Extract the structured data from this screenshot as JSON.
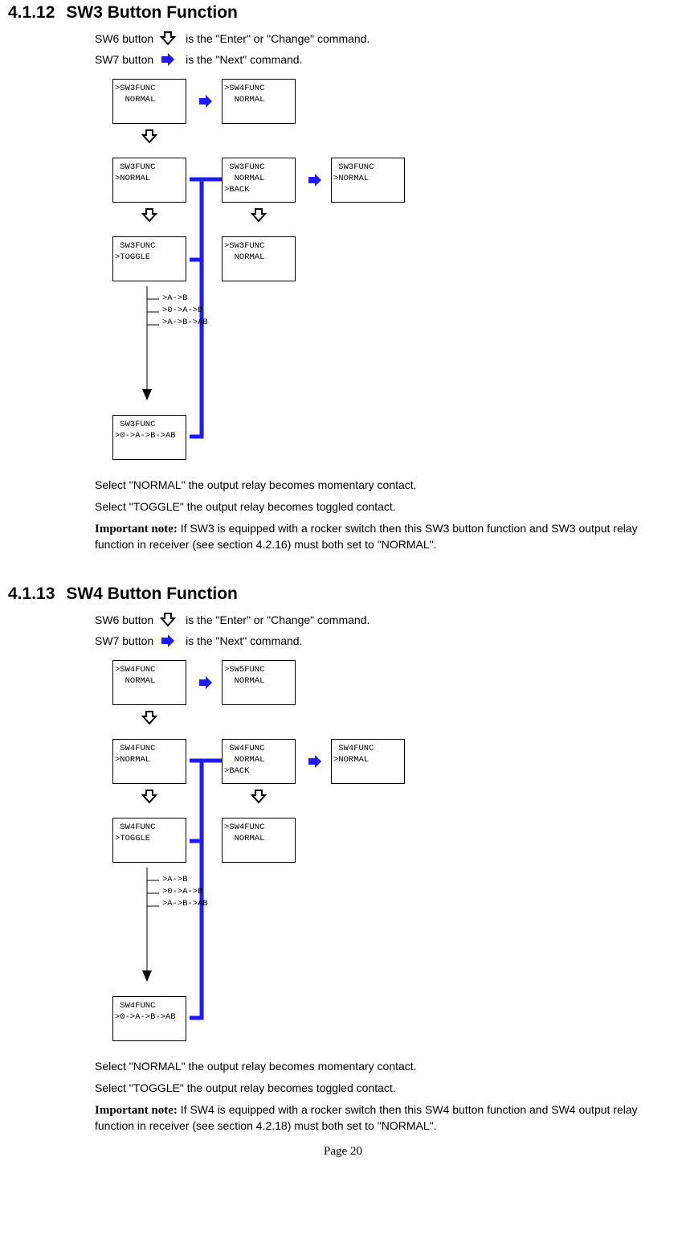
{
  "sections": [
    {
      "number": "4.1.12",
      "title": "SW3 Button Function",
      "sw6_before": "SW6 button",
      "sw6_after": "is the \"Enter\" or \"Change\" command.",
      "sw7_before": "SW7 button",
      "sw7_after": "is the \"Next\" command.",
      "boxes": {
        "top1": {
          "l1": ">SW3FUNC",
          "l2": "  NORMAL"
        },
        "top2": {
          "l1": ">SW4FUNC",
          "l2": "  NORMAL"
        },
        "r2a": {
          "l1": " SW3FUNC",
          "l2": ">NORMAL"
        },
        "r2b": {
          "l1": " SW3FUNC",
          "l2": "  NORMAL",
          "l3": ">BACK"
        },
        "r2c": {
          "l1": " SW3FUNC",
          "l2": ">NORMAL"
        },
        "r3a": {
          "l1": " SW3FUNC",
          "l2": ">TOGGLE"
        },
        "r3b": {
          "l1": ">SW3FUNC",
          "l2": "  NORMAL"
        },
        "r5a": {
          "l1": " SW3FUNC",
          "l2": ">0->A->B->AB"
        },
        "opts": {
          "o1": ">A->B",
          "o2": ">0->A->B",
          "o3": ">A->B->AB"
        }
      },
      "para1": "Select \"NORMAL\" the output relay becomes momentary contact.",
      "para2": "Select \"TOGGLE\" the output relay becomes toggled contact.",
      "note_label": "Important note:",
      "note_text": " If SW3 is equipped with a rocker switch then this SW3 button function and SW3 output relay function in receiver (see section 4.2.16) must both set to \"NORMAL\"."
    },
    {
      "number": "4.1.13",
      "title": "SW4 Button Function",
      "sw6_before": "SW6 button",
      "sw6_after": "is the \"Enter\" or \"Change\" command.",
      "sw7_before": "SW7 button",
      "sw7_after": "is the \"Next\" command.",
      "boxes": {
        "top1": {
          "l1": ">SW4FUNC",
          "l2": "  NORMAL"
        },
        "top2": {
          "l1": ">SW5FUNC",
          "l2": "  NORMAL"
        },
        "r2a": {
          "l1": " SW4FUNC",
          "l2": ">NORMAL"
        },
        "r2b": {
          "l1": " SW4FUNC",
          "l2": "  NORMAL",
          "l3": ">BACK"
        },
        "r2c": {
          "l1": " SW4FUNC",
          "l2": ">NORMAL"
        },
        "r3a": {
          "l1": " SW4FUNC",
          "l2": ">TOGGLE"
        },
        "r3b": {
          "l1": ">SW4FUNC",
          "l2": "  NORMAL"
        },
        "r5a": {
          "l1": " SW4FUNC",
          "l2": ">0->A->B->AB"
        },
        "opts": {
          "o1": ">A->B",
          "o2": ">0->A->B",
          "o3": ">A->B->AB"
        }
      },
      "para1": "Select \"NORMAL\" the output relay becomes momentary contact.",
      "para2": "Select \"TOGGLE\" the output relay becomes toggled contact.",
      "note_label": "Important note:",
      "note_text": " If SW4 is equipped with a rocker switch then this SW4 button function and SW4 output relay function in receiver (see section 4.2.18) must both set to \"NORMAL\"."
    }
  ],
  "page_label": "Page 20"
}
